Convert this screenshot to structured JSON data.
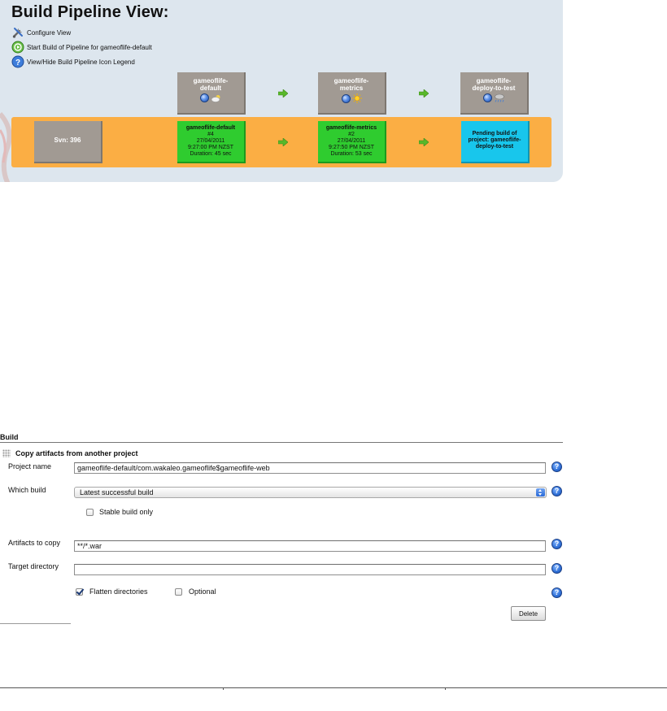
{
  "pipeline": {
    "title": "Build Pipeline View:",
    "menu": [
      {
        "label": "Configure View",
        "icon": "configure-icon"
      },
      {
        "label": "Start Build of Pipeline for gameoflife-default",
        "icon": "start-build-icon"
      },
      {
        "label": "View/Hide Build Pipeline Icon Legend",
        "icon": "legend-help-icon"
      }
    ],
    "jobs": [
      {
        "name_line1": "gameoflife-",
        "name_line2": "default",
        "status_icon": "blue-ball-icon",
        "health_icon": "cloudy-weather-icon"
      },
      {
        "name_line1": "gameoflife-",
        "name_line2": "metrics",
        "status_icon": "blue-ball-icon",
        "health_icon": "sunny-weather-icon"
      },
      {
        "name_line1": "gameoflife-",
        "name_line2": "deploy-to-test",
        "status_icon": "blue-ball-icon",
        "health_icon": "rain-weather-icon"
      }
    ],
    "revision": "Svn: 396",
    "builds": [
      {
        "name": "gameoflife-default",
        "number": "#4",
        "date": "27/04/2011",
        "time": "9:27:00 PM NZST",
        "duration": "Duration: 45 sec",
        "status": "success"
      },
      {
        "name": "gameoflife-metrics",
        "number": "#2",
        "date": "27/04/2011",
        "time": "9:27:50 PM NZST",
        "duration": "Duration: 53 sec",
        "status": "success"
      }
    ],
    "pending": {
      "line1": "Pending build of",
      "line2": "project: gameoflife-",
      "line3": "deploy-to-test"
    },
    "colors": {
      "panel_bg": "#dde6ee",
      "job_gray": "#a19a93",
      "build_row_orange": "#fbae44",
      "success_green": "#2fcc2f",
      "pending_cyan": "#18c6ec",
      "arrow_green": "#58b82a"
    }
  },
  "build_form": {
    "section_title": "Build",
    "step_title": "Copy artifacts from another project",
    "project_name": {
      "label": "Project name",
      "value": "gameoflife-default/com.wakaleo.gameoflife$gameoflife-web"
    },
    "which_build": {
      "label": "Which build",
      "selected": "Latest successful build"
    },
    "stable_only": {
      "label": "Stable build only",
      "checked": false
    },
    "artifacts": {
      "label": "Artifacts to copy",
      "value": "**/*.war"
    },
    "target_dir": {
      "label": "Target directory",
      "value": ""
    },
    "flatten": {
      "label": "Flatten directories",
      "checked": true
    },
    "optional": {
      "label": "Optional",
      "checked": false
    },
    "help_symbol": "?",
    "delete_label": "Delete"
  }
}
